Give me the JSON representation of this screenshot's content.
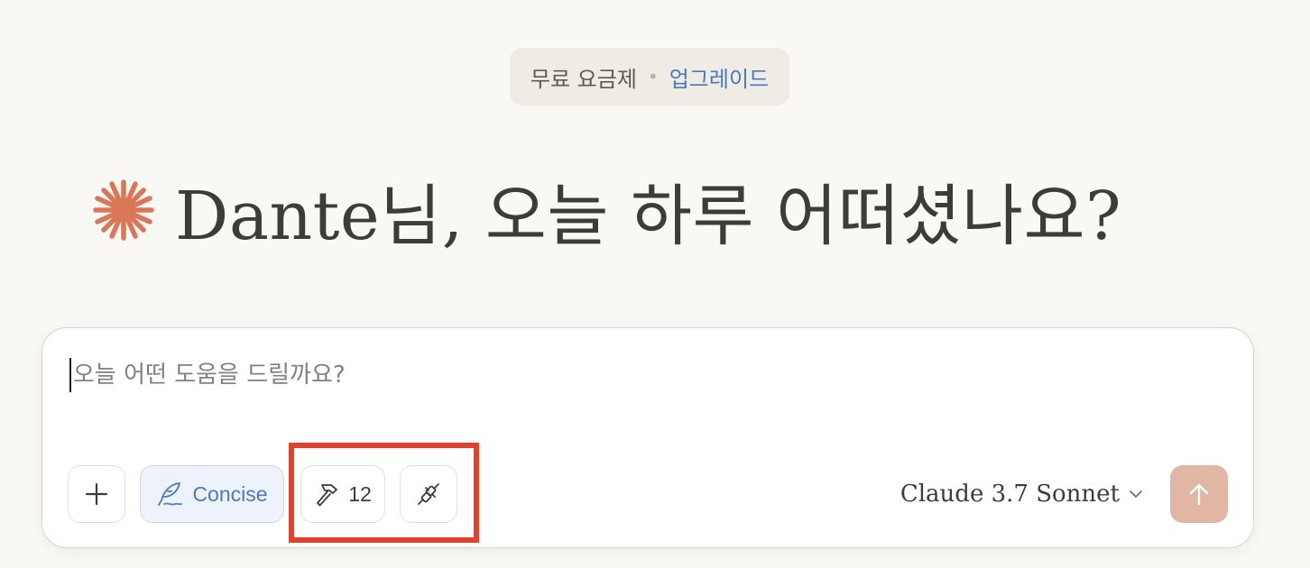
{
  "plan_banner": {
    "plan_label": "무료 요금제",
    "separator": "•",
    "upgrade_label": "업그레이드"
  },
  "greeting": {
    "text": "Dante님, 오늘 하루 어떠셨나요?",
    "icon": "claude-starburst-icon"
  },
  "composer": {
    "placeholder": "오늘 어떤 도움을 드릴까요?",
    "add_icon": "plus-icon",
    "style_button": {
      "label": "Concise",
      "icon": "feather-icon"
    },
    "tools_button": {
      "count": "12",
      "icon": "hammer-icon"
    },
    "integrations_icon": "plug-icon",
    "model": {
      "name": "Claude 3.7 Sonnet",
      "icon": "chevron-down-icon"
    },
    "send_icon": "arrow-up-icon"
  },
  "colors": {
    "background": "#faf8f4",
    "accent_star": "#d97757",
    "upgrade_link": "#4a79c4",
    "send_button": "#e1b6a5",
    "highlight": "#e5412a"
  }
}
